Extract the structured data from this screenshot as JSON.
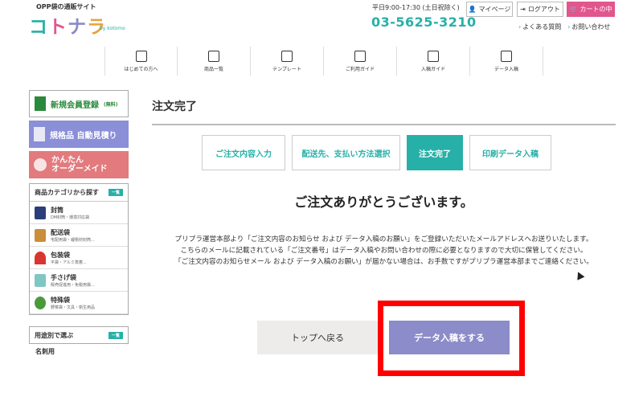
{
  "header": {
    "tagline": "OPP袋の通販サイト",
    "logo": [
      "コ",
      "ト",
      "ナ",
      "ラ"
    ],
    "logo_by": "by kotomo",
    "hours": "平日9:00-17:30 (土日祝除く)",
    "phone": "03-5625-3210",
    "mypage": "マイページ",
    "logout": "ログアウト",
    "cart": "カートの中",
    "faq": "よくある質問",
    "contact": "お問い合わせ"
  },
  "nav": [
    "はじめての方へ",
    "商品一覧",
    "テンプレート",
    "ご利用ガイド",
    "入稿ガイド",
    "データ入稿"
  ],
  "sidebar": {
    "register": "新規会員登録",
    "register_note": "(無料)",
    "quote": "規格品 自動見積り",
    "order_line1": "かんたん",
    "order_line2": "オーダーメイド",
    "category_title": "商品カテゴリから探す",
    "category_tag": "一覧",
    "categories": [
      {
        "name": "封筒",
        "desc": "DM封筒・環境対応袋"
      },
      {
        "name": "配送袋",
        "desc": "宅配用袋・緩衝材封筒..."
      },
      {
        "name": "包装袋",
        "desc": "平袋・アルミ蒸着..."
      },
      {
        "name": "手さげ袋",
        "desc": "販売促進用・免税用袋..."
      },
      {
        "name": "特殊袋",
        "desc": "野菜袋・文具・衛生用品"
      }
    ],
    "use_title": "用途別で選ぶ",
    "use_tag": "一覧",
    "more_item": "名刺用"
  },
  "main": {
    "title": "注文完了",
    "steps": [
      "ご注文内容入力",
      "配送先、支払い方法選択",
      "注文完了",
      "印刷データ入稿"
    ],
    "thanks": "ご注文ありがとうございます。",
    "msg1": "プリプラ運営本部より「ご注文内容のお知らせ および データ入稿のお願い」をご登録いただいたメールアドレスへお送りいたします。",
    "msg2": "こちらのメールに記載されている「ご注文番号」はデータ入稿やお問い合わせの際に必要となりますので大切に保管してください。",
    "msg3": "「ご注文内容のお知らせメール および データ入稿のお願い」が届かない場合は、お手数ですがプリプラ運営本部までご連絡ください。",
    "btn_top": "トップへ戻る",
    "btn_data": "データ入稿をする"
  },
  "colors": {
    "accent": "#27b0a8",
    "pink": "#e2568e",
    "purple": "#8b8cc9",
    "highlight": "#ff0000"
  }
}
